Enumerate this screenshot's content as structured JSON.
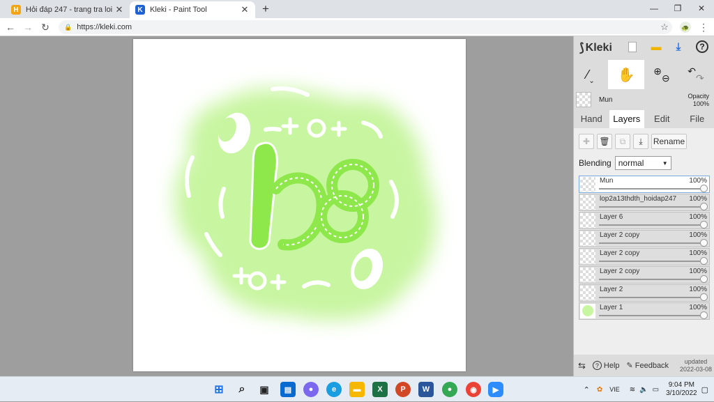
{
  "browser": {
    "tabs": [
      {
        "title": "Hỏi đáp 247 - trang tra loi",
        "favicon": "H",
        "favicon_color": "#f2a516"
      },
      {
        "title": "Kleki - Paint Tool",
        "favicon": "K",
        "favicon_color": "#1e63d6"
      }
    ],
    "new_tab": "+",
    "url": "https://kleki.com"
  },
  "kleki": {
    "logo": "Kleki",
    "layer_name": "Mun",
    "opacity_label": "Opacity",
    "opacity_value": "100%",
    "tabs": [
      "Hand",
      "Layers",
      "Edit",
      "File"
    ],
    "active_tab": "Layers",
    "rename_label": "Rename",
    "blending_label": "Blending",
    "blending_value": "normal",
    "layers": [
      {
        "name": "Mun",
        "opacity": "100%",
        "active": true
      },
      {
        "name": "lop2a13thdth_hoidap247",
        "opacity": "100%"
      },
      {
        "name": "Layer 6",
        "opacity": "100%"
      },
      {
        "name": "Layer 2 copy",
        "opacity": "100%"
      },
      {
        "name": "Layer 2 copy",
        "opacity": "100%"
      },
      {
        "name": "Layer 2 copy",
        "opacity": "100%"
      },
      {
        "name": "Layer 2",
        "opacity": "100%"
      },
      {
        "name": "Layer 1",
        "opacity": "100%"
      }
    ],
    "footer": {
      "help": "Help",
      "feedback": "Feedback",
      "updated_label": "updated",
      "updated_date": "2022-03-08"
    }
  },
  "artwork": {
    "text": "lớp 10",
    "glow_color": "#c8f5a0",
    "letter_color": "#8ee84c"
  },
  "taskbar": {
    "language": "VIE",
    "time": "9:04 PM",
    "date": "3/10/2022"
  }
}
